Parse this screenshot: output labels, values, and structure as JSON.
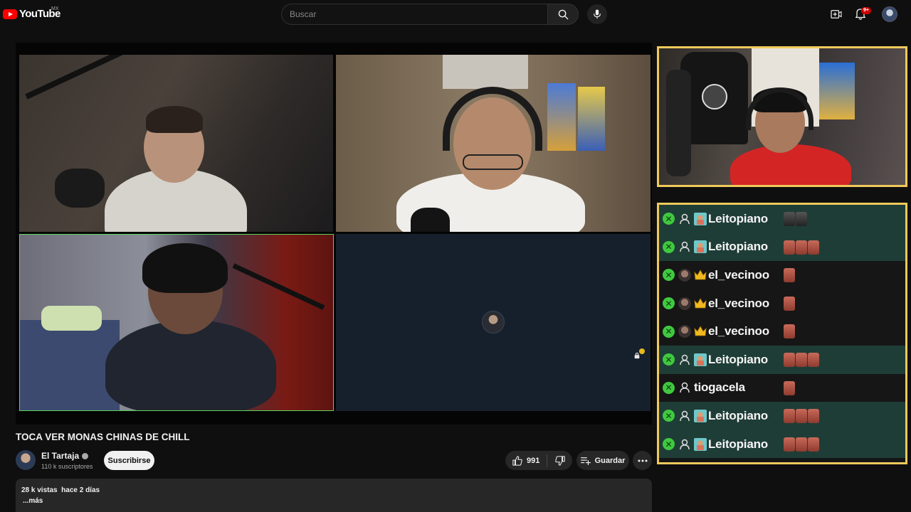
{
  "header": {
    "logo_text": "YouTube",
    "country_code": "MX",
    "search_placeholder": "Buscar",
    "notification_count": "9+"
  },
  "player": {
    "participants": [
      {
        "id": "tile-1",
        "active_speaker": false
      },
      {
        "id": "tile-2",
        "active_speaker": false
      },
      {
        "id": "tile-3",
        "active_speaker": true
      },
      {
        "id": "tile-4",
        "camera_off": true
      }
    ]
  },
  "chat": {
    "messages": [
      {
        "user": "Leitopiano",
        "badge": "sub",
        "highlight": true,
        "emotes": 2,
        "emote_style": "dark"
      },
      {
        "user": "Leitopiano",
        "badge": "sub",
        "highlight": true,
        "emotes": 3,
        "emote_style": "red"
      },
      {
        "user": "el_vecinoo",
        "badge": "crown",
        "highlight": false,
        "emotes": 1,
        "emote_style": "red"
      },
      {
        "user": "el_vecinoo",
        "badge": "crown",
        "highlight": false,
        "emotes": 1,
        "emote_style": "red"
      },
      {
        "user": "el_vecinoo",
        "badge": "crown",
        "highlight": false,
        "emotes": 1,
        "emote_style": "red"
      },
      {
        "user": "Leitopiano",
        "badge": "sub",
        "highlight": true,
        "emotes": 3,
        "emote_style": "red"
      },
      {
        "user": "tiogacela",
        "badge": "none",
        "highlight": false,
        "emotes": 1,
        "emote_style": "red"
      },
      {
        "user": "Leitopiano",
        "badge": "sub",
        "highlight": true,
        "emotes": 3,
        "emote_style": "red"
      },
      {
        "user": "Leitopiano",
        "badge": "sub",
        "highlight": true,
        "emotes": 3,
        "emote_style": "red"
      }
    ]
  },
  "video": {
    "title": "TOCA VER MONAS CHINAS DE CHILL",
    "channel_name": "El Tartaja",
    "subscribers": "110 k suscriptores",
    "subscribe_label": "Suscribirse",
    "like_count": "991",
    "save_label": "Guardar",
    "views_date": "28 k vistas  hace 2 días",
    "more_label": "...más"
  },
  "colors": {
    "brand_red": "#ff0000",
    "panel_border": "#f0c95b",
    "chat_highlight": "#1f3d37",
    "badge_green": "#3fc93f",
    "active_speaker_border": "#5fd35f"
  },
  "icons": [
    "youtube-logo-icon",
    "search-icon",
    "mic-icon",
    "create-icon",
    "bell-icon",
    "like-icon",
    "dislike-icon",
    "save-playlist-icon",
    "more-icon",
    "lock-icon",
    "verified-icon",
    "crown-icon",
    "person-icon"
  ]
}
